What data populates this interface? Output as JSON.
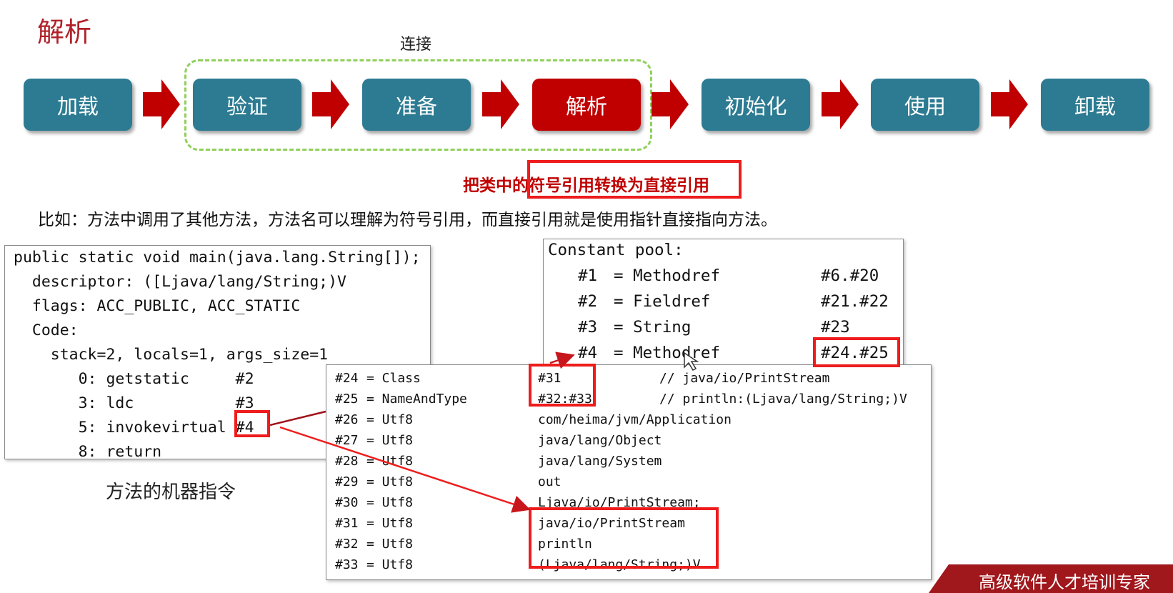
{
  "slide": {
    "title": "解析",
    "link_label": "连接",
    "note": "把类中的符号引用转换为直接引用",
    "example": "比如：方法中调用了其他方法，方法名可以理解为符号引用，而直接引用就是使用指针直接指向方法。",
    "caption": "方法的机器指令",
    "banner": "高级软件人才培训专家"
  },
  "stages": [
    "加载",
    "验证",
    "准备",
    "解析",
    "初始化",
    "使用",
    "卸载"
  ],
  "active_stage": "解析",
  "colors": {
    "stage": "#2c7b92",
    "active": "#c00000",
    "arrow": "#c00000",
    "highlight": "#ee1c1c",
    "dash": "#8fd05a"
  },
  "method_code": {
    "lines": [
      "public static void main(java.lang.String[]);",
      "  descriptor: ([Ljava/lang/String;)V",
      "  flags: ACC_PUBLIC, ACC_STATIC",
      "  Code:",
      "    stack=2, locals=1, args_size=1",
      "       0: getstatic     #2",
      "       3: ldc           #3",
      "       5: invokevirtual #4",
      "       8: return"
    ]
  },
  "constant_pool": {
    "header": "Constant pool:",
    "entries": [
      {
        "idx": "#1",
        "type": "= Methodref",
        "ref": "#6.#20"
      },
      {
        "idx": "#2",
        "type": "= Fieldref",
        "ref": "#21.#22"
      },
      {
        "idx": "#3",
        "type": "= String",
        "ref": "#23"
      },
      {
        "idx": "#4",
        "type": "= Methodref",
        "ref": "#24.#25"
      }
    ]
  },
  "pool_table": [
    {
      "idx": "#24",
      "type": "= Class",
      "val": "#31",
      "comment": "// java/io/PrintStream"
    },
    {
      "idx": "#25",
      "type": "= NameAndType",
      "val": "#32:#33",
      "comment": "// println:(Ljava/lang/String;)V"
    },
    {
      "idx": "#26",
      "type": "= Utf8",
      "val": "com/heima/jvm/Application",
      "comment": ""
    },
    {
      "idx": "#27",
      "type": "= Utf8",
      "val": "java/lang/Object",
      "comment": ""
    },
    {
      "idx": "#28",
      "type": "= Utf8",
      "val": "java/lang/System",
      "comment": ""
    },
    {
      "idx": "#29",
      "type": "= Utf8",
      "val": "out",
      "comment": ""
    },
    {
      "idx": "#30",
      "type": "= Utf8",
      "val": "Ljava/io/PrintStream;",
      "comment": ""
    },
    {
      "idx": "#31",
      "type": "= Utf8",
      "val": "java/io/PrintStream",
      "comment": ""
    },
    {
      "idx": "#32",
      "type": "= Utf8",
      "val": "println",
      "comment": ""
    },
    {
      "idx": "#33",
      "type": "= Utf8",
      "val": "(Ljava/lang/String;)V",
      "comment": ""
    }
  ]
}
